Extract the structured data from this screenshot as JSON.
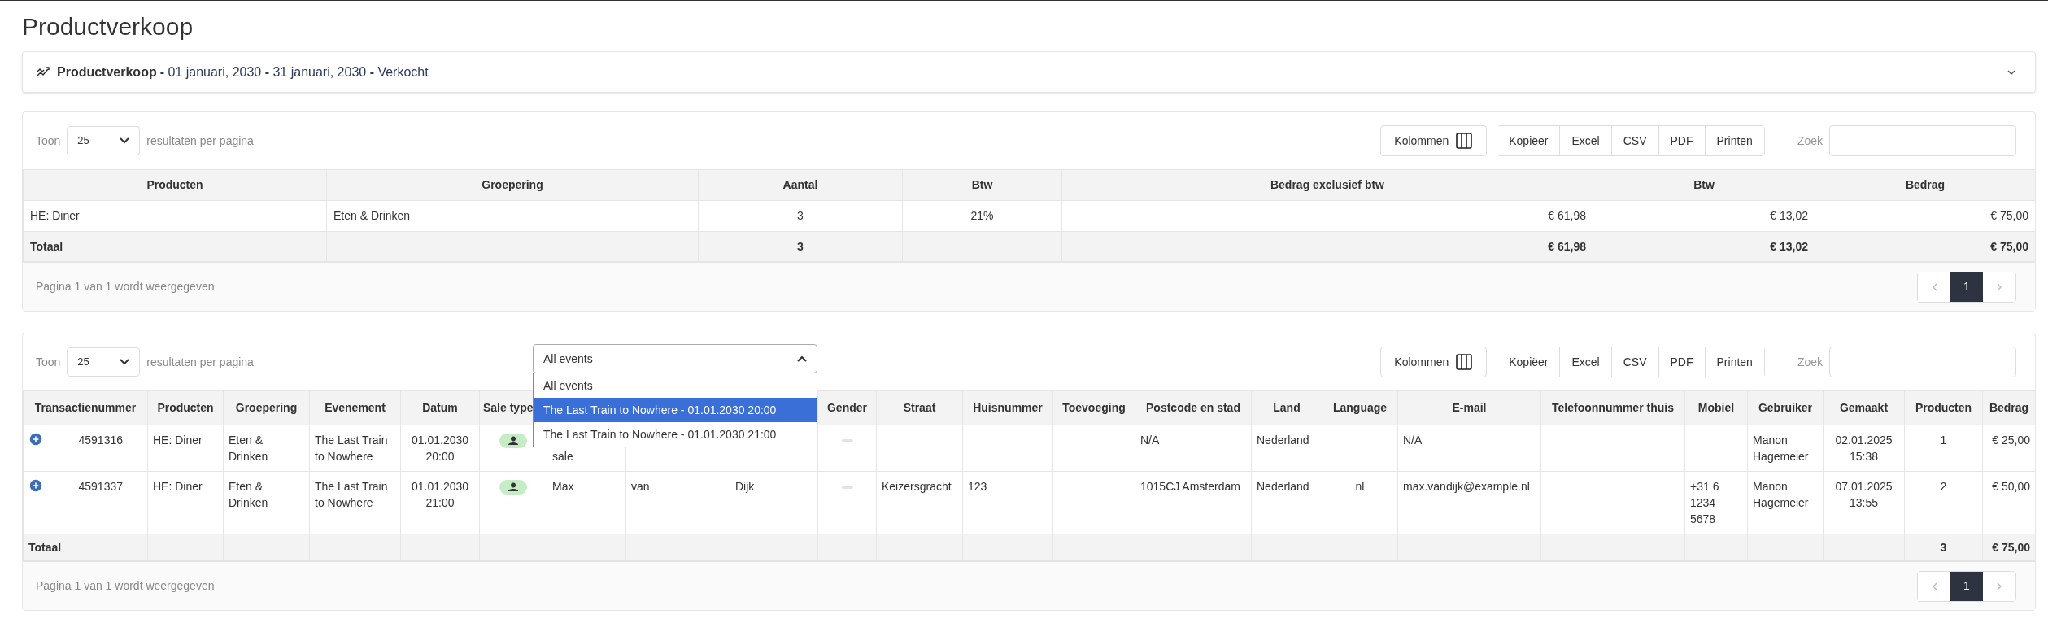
{
  "page_title": "Productverkoop",
  "report_header": {
    "title": "Productverkoop",
    "subtitle": "**-** 01 januari, 2030 **-** 31 januari, 2030 **-** Verkocht",
    "expanded": false
  },
  "summary_table": {
    "toolbar": {
      "show_label": "Toon",
      "page_size": "25",
      "per_page_label": "resultaten per pagina",
      "columns_button": "Kolommen",
      "export_buttons": [
        "Kopiëer",
        "Excel",
        "CSV",
        "PDF",
        "Printen"
      ],
      "search_label": "Zoek"
    },
    "columns": [
      "Producten",
      "Groepering",
      "Aantal",
      "Btw",
      "Bedrag exclusief btw",
      "Btw",
      "Bedrag"
    ],
    "rows": [
      [
        "HE: Diner",
        "Eten & Drinken",
        "3",
        "21%",
        "€ 61,98",
        "€ 13,02",
        "€ 75,00"
      ]
    ],
    "totals": {
      "label": "Totaal",
      "quantity": "3",
      "amount_excl_vat": "€ 61,98",
      "vat_amount": "€ 13,02",
      "amount": "€ 75,00"
    },
    "info": "Pagina 1 van 1 wordt weergegeven",
    "pages": [
      {
        "label": "1",
        "selected": true
      }
    ]
  },
  "transactions_table": {
    "toolbar": {
      "show_label": "Toon",
      "page_size": "25",
      "per_page_label": "resultaten per pagina",
      "columns_button": "Kolommen",
      "export_buttons": [
        "Kopiëer",
        "Excel",
        "CSV",
        "PDF",
        "Printen"
      ],
      "search_label": "Zoek"
    },
    "event_filter": {
      "value": "All events",
      "expanded": true,
      "options": [
        {
          "label": "All events",
          "highlighted": false
        },
        {
          "label": "The Last Train to Nowhere - 01.01.2030 20:00",
          "highlighted": true
        },
        {
          "label": "The Last Train to Nowhere - 01.01.2030 21:00",
          "highlighted": false
        }
      ]
    },
    "columns": [
      "Transactienummer",
      "Producten",
      "Groepering",
      "Evenement",
      "Datum",
      "Sale type",
      "Gender",
      "Straat",
      "Huisnummer",
      "Toevoeging",
      "Postcode en stad",
      "Land",
      "Language",
      "E-mail",
      "Telefoonnummer thuis",
      "Mobiel",
      "Gebruiker",
      "Gemaakt",
      "Producten",
      "Bedrag"
    ],
    "rows": [
      {
        "expanded": false,
        "transaction": "4591316",
        "products": "HE: Diner",
        "grouping": "Eten & Drinken",
        "event": "The Last Train to Nowhere",
        "date": "01.01.2030 20:00",
        "sale_type": {
          "kind": "person"
        },
        "column_7": {
          "text": "sale",
          "covered": true
        },
        "gender": {
          "kind": "none"
        },
        "postcode_city": "N/A",
        "country": "Nederland",
        "email": "N/A",
        "user": "Manon Hagemeier",
        "created": "02.01.2025 15:38",
        "product_count": "1",
        "amount": "€ 25,00"
      },
      {
        "expanded": false,
        "transaction": "4591337",
        "products": "HE: Diner",
        "grouping": "Eten & Drinken",
        "event": "The Last Train to Nowhere",
        "date": "01.01.2030 21:00",
        "sale_type": {
          "kind": "person"
        },
        "column_7": "Max",
        "column_8": "van",
        "column_9": "Dijk",
        "gender": {
          "kind": "none"
        },
        "street": "Keizersgracht",
        "house_number": "123",
        "postcode_city": "1015CJ Amsterdam",
        "country": "Nederland",
        "language": "nl",
        "email": "max.vandijk@example.nl",
        "mobile": "+31 6 1234 5678",
        "user": "Manon Hagemeier",
        "created": "07.01.2025 13:55",
        "product_count": "2",
        "amount": "€ 50,00"
      }
    ],
    "totals": {
      "label": "Totaal",
      "product_count": "3",
      "amount": "€ 75,00"
    },
    "info": "Pagina 1 van 1 wordt weergegeven",
    "pages": [
      {
        "label": "1",
        "selected": true
      }
    ]
  }
}
